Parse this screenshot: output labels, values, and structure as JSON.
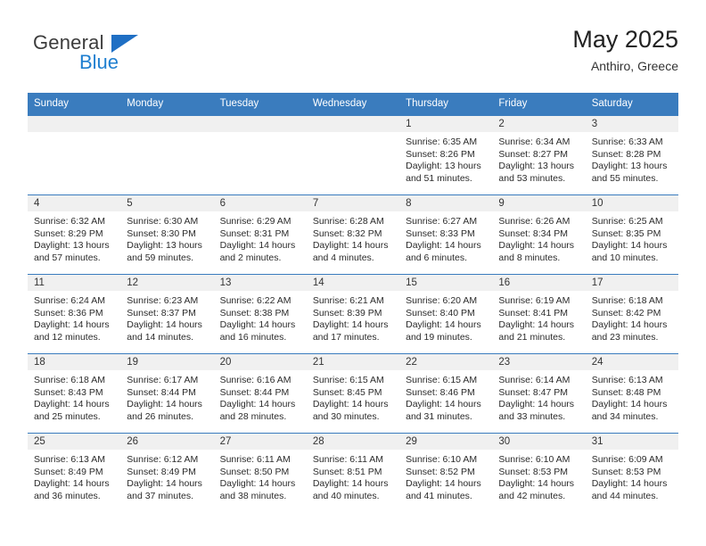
{
  "brand": {
    "line1": "General",
    "line2": "Blue",
    "triangle_color": "#1f6fc4",
    "blue_color": "#1f7fd0",
    "general_color": "#3c3c3c"
  },
  "header": {
    "title": "May 2025",
    "subtitle": "Anthiro, Greece"
  },
  "theme": {
    "header_band": "#3a7cbe",
    "daynum_band": "#f0f0f0",
    "text": "#2b2b2b"
  },
  "weekday_headers": [
    "Sunday",
    "Monday",
    "Tuesday",
    "Wednesday",
    "Thursday",
    "Friday",
    "Saturday"
  ],
  "labels": {
    "sunrise_prefix": "Sunrise: ",
    "sunset_prefix": "Sunset: ",
    "daylight_prefix": "Daylight: "
  },
  "weeks": [
    [
      {
        "day": "",
        "sunrise": "",
        "sunset": "",
        "daylight_line1": "",
        "daylight_line2": ""
      },
      {
        "day": "",
        "sunrise": "",
        "sunset": "",
        "daylight_line1": "",
        "daylight_line2": ""
      },
      {
        "day": "",
        "sunrise": "",
        "sunset": "",
        "daylight_line1": "",
        "daylight_line2": ""
      },
      {
        "day": "",
        "sunrise": "",
        "sunset": "",
        "daylight_line1": "",
        "daylight_line2": ""
      },
      {
        "day": "1",
        "sunrise": "Sunrise: 6:35 AM",
        "sunset": "Sunset: 8:26 PM",
        "daylight_line1": "Daylight: 13 hours",
        "daylight_line2": "and 51 minutes."
      },
      {
        "day": "2",
        "sunrise": "Sunrise: 6:34 AM",
        "sunset": "Sunset: 8:27 PM",
        "daylight_line1": "Daylight: 13 hours",
        "daylight_line2": "and 53 minutes."
      },
      {
        "day": "3",
        "sunrise": "Sunrise: 6:33 AM",
        "sunset": "Sunset: 8:28 PM",
        "daylight_line1": "Daylight: 13 hours",
        "daylight_line2": "and 55 minutes."
      }
    ],
    [
      {
        "day": "4",
        "sunrise": "Sunrise: 6:32 AM",
        "sunset": "Sunset: 8:29 PM",
        "daylight_line1": "Daylight: 13 hours",
        "daylight_line2": "and 57 minutes."
      },
      {
        "day": "5",
        "sunrise": "Sunrise: 6:30 AM",
        "sunset": "Sunset: 8:30 PM",
        "daylight_line1": "Daylight: 13 hours",
        "daylight_line2": "and 59 minutes."
      },
      {
        "day": "6",
        "sunrise": "Sunrise: 6:29 AM",
        "sunset": "Sunset: 8:31 PM",
        "daylight_line1": "Daylight: 14 hours",
        "daylight_line2": "and 2 minutes."
      },
      {
        "day": "7",
        "sunrise": "Sunrise: 6:28 AM",
        "sunset": "Sunset: 8:32 PM",
        "daylight_line1": "Daylight: 14 hours",
        "daylight_line2": "and 4 minutes."
      },
      {
        "day": "8",
        "sunrise": "Sunrise: 6:27 AM",
        "sunset": "Sunset: 8:33 PM",
        "daylight_line1": "Daylight: 14 hours",
        "daylight_line2": "and 6 minutes."
      },
      {
        "day": "9",
        "sunrise": "Sunrise: 6:26 AM",
        "sunset": "Sunset: 8:34 PM",
        "daylight_line1": "Daylight: 14 hours",
        "daylight_line2": "and 8 minutes."
      },
      {
        "day": "10",
        "sunrise": "Sunrise: 6:25 AM",
        "sunset": "Sunset: 8:35 PM",
        "daylight_line1": "Daylight: 14 hours",
        "daylight_line2": "and 10 minutes."
      }
    ],
    [
      {
        "day": "11",
        "sunrise": "Sunrise: 6:24 AM",
        "sunset": "Sunset: 8:36 PM",
        "daylight_line1": "Daylight: 14 hours",
        "daylight_line2": "and 12 minutes."
      },
      {
        "day": "12",
        "sunrise": "Sunrise: 6:23 AM",
        "sunset": "Sunset: 8:37 PM",
        "daylight_line1": "Daylight: 14 hours",
        "daylight_line2": "and 14 minutes."
      },
      {
        "day": "13",
        "sunrise": "Sunrise: 6:22 AM",
        "sunset": "Sunset: 8:38 PM",
        "daylight_line1": "Daylight: 14 hours",
        "daylight_line2": "and 16 minutes."
      },
      {
        "day": "14",
        "sunrise": "Sunrise: 6:21 AM",
        "sunset": "Sunset: 8:39 PM",
        "daylight_line1": "Daylight: 14 hours",
        "daylight_line2": "and 17 minutes."
      },
      {
        "day": "15",
        "sunrise": "Sunrise: 6:20 AM",
        "sunset": "Sunset: 8:40 PM",
        "daylight_line1": "Daylight: 14 hours",
        "daylight_line2": "and 19 minutes."
      },
      {
        "day": "16",
        "sunrise": "Sunrise: 6:19 AM",
        "sunset": "Sunset: 8:41 PM",
        "daylight_line1": "Daylight: 14 hours",
        "daylight_line2": "and 21 minutes."
      },
      {
        "day": "17",
        "sunrise": "Sunrise: 6:18 AM",
        "sunset": "Sunset: 8:42 PM",
        "daylight_line1": "Daylight: 14 hours",
        "daylight_line2": "and 23 minutes."
      }
    ],
    [
      {
        "day": "18",
        "sunrise": "Sunrise: 6:18 AM",
        "sunset": "Sunset: 8:43 PM",
        "daylight_line1": "Daylight: 14 hours",
        "daylight_line2": "and 25 minutes."
      },
      {
        "day": "19",
        "sunrise": "Sunrise: 6:17 AM",
        "sunset": "Sunset: 8:44 PM",
        "daylight_line1": "Daylight: 14 hours",
        "daylight_line2": "and 26 minutes."
      },
      {
        "day": "20",
        "sunrise": "Sunrise: 6:16 AM",
        "sunset": "Sunset: 8:44 PM",
        "daylight_line1": "Daylight: 14 hours",
        "daylight_line2": "and 28 minutes."
      },
      {
        "day": "21",
        "sunrise": "Sunrise: 6:15 AM",
        "sunset": "Sunset: 8:45 PM",
        "daylight_line1": "Daylight: 14 hours",
        "daylight_line2": "and 30 minutes."
      },
      {
        "day": "22",
        "sunrise": "Sunrise: 6:15 AM",
        "sunset": "Sunset: 8:46 PM",
        "daylight_line1": "Daylight: 14 hours",
        "daylight_line2": "and 31 minutes."
      },
      {
        "day": "23",
        "sunrise": "Sunrise: 6:14 AM",
        "sunset": "Sunset: 8:47 PM",
        "daylight_line1": "Daylight: 14 hours",
        "daylight_line2": "and 33 minutes."
      },
      {
        "day": "24",
        "sunrise": "Sunrise: 6:13 AM",
        "sunset": "Sunset: 8:48 PM",
        "daylight_line1": "Daylight: 14 hours",
        "daylight_line2": "and 34 minutes."
      }
    ],
    [
      {
        "day": "25",
        "sunrise": "Sunrise: 6:13 AM",
        "sunset": "Sunset: 8:49 PM",
        "daylight_line1": "Daylight: 14 hours",
        "daylight_line2": "and 36 minutes."
      },
      {
        "day": "26",
        "sunrise": "Sunrise: 6:12 AM",
        "sunset": "Sunset: 8:49 PM",
        "daylight_line1": "Daylight: 14 hours",
        "daylight_line2": "and 37 minutes."
      },
      {
        "day": "27",
        "sunrise": "Sunrise: 6:11 AM",
        "sunset": "Sunset: 8:50 PM",
        "daylight_line1": "Daylight: 14 hours",
        "daylight_line2": "and 38 minutes."
      },
      {
        "day": "28",
        "sunrise": "Sunrise: 6:11 AM",
        "sunset": "Sunset: 8:51 PM",
        "daylight_line1": "Daylight: 14 hours",
        "daylight_line2": "and 40 minutes."
      },
      {
        "day": "29",
        "sunrise": "Sunrise: 6:10 AM",
        "sunset": "Sunset: 8:52 PM",
        "daylight_line1": "Daylight: 14 hours",
        "daylight_line2": "and 41 minutes."
      },
      {
        "day": "30",
        "sunrise": "Sunrise: 6:10 AM",
        "sunset": "Sunset: 8:53 PM",
        "daylight_line1": "Daylight: 14 hours",
        "daylight_line2": "and 42 minutes."
      },
      {
        "day": "31",
        "sunrise": "Sunrise: 6:09 AM",
        "sunset": "Sunset: 8:53 PM",
        "daylight_line1": "Daylight: 14 hours",
        "daylight_line2": "and 44 minutes."
      }
    ]
  ]
}
